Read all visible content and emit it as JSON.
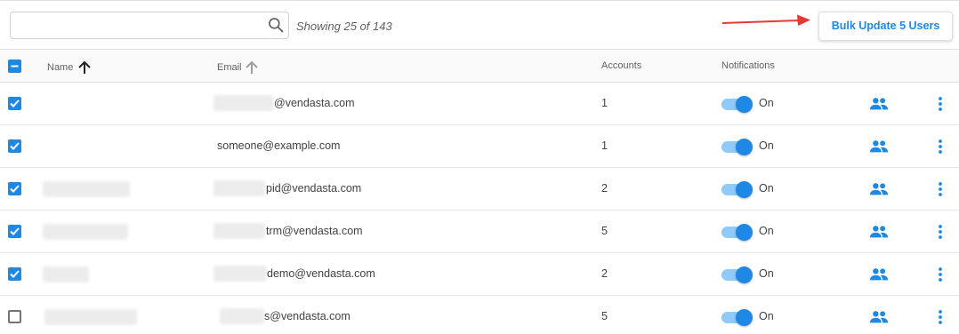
{
  "toolbar": {
    "search_placeholder": "",
    "showing_text": "Showing 25 of 143",
    "bulk_button_label": "Bulk Update 5 Users"
  },
  "table": {
    "columns": {
      "name": "Name",
      "email": "Email",
      "accounts": "Accounts",
      "notifications": "Notifications"
    },
    "rows": [
      {
        "checked": true,
        "email_visible": "@vendasta.com",
        "accounts": "1",
        "notifications": "On"
      },
      {
        "checked": true,
        "email_visible": "someone@example.com",
        "accounts": "1",
        "notifications": "On"
      },
      {
        "checked": true,
        "email_visible": "pid@vendasta.com",
        "accounts": "2",
        "notifications": "On"
      },
      {
        "checked": true,
        "email_visible": "trm@vendasta.com",
        "accounts": "5",
        "notifications": "On"
      },
      {
        "checked": true,
        "email_visible": "demo@vendasta.com",
        "accounts": "2",
        "notifications": "On"
      },
      {
        "checked": false,
        "email_visible": "s@vendasta.com",
        "accounts": "5",
        "notifications": "On"
      }
    ]
  },
  "colors": {
    "accent": "#1e88e5",
    "toggle_track": "#90caf9",
    "annotation_arrow": "#e53935"
  },
  "icons": {
    "search": "search-icon",
    "sort_asc": "arrow-up-icon",
    "row_users": "people-icon",
    "row_menu": "more-vert-icon"
  }
}
